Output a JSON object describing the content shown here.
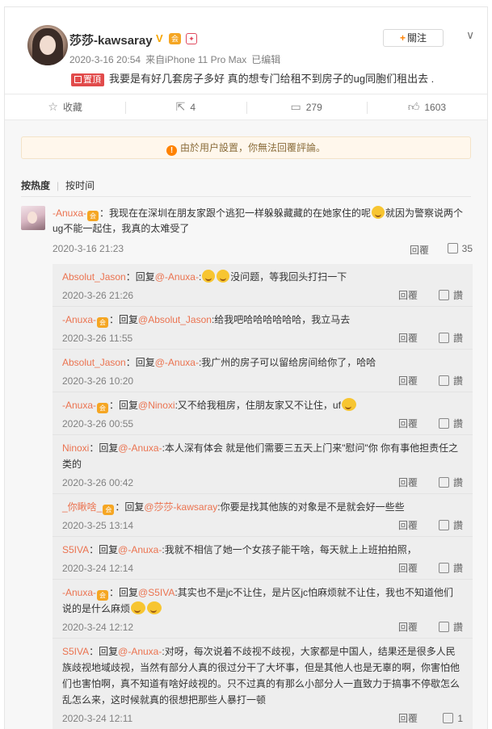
{
  "post": {
    "username": "莎莎-kawsaray",
    "verified_badge": "V",
    "level_badge": "会",
    "timestamp": "2020-3-16 20:54",
    "source": "来自iPhone 11 Pro Max",
    "edited": "已编辑",
    "follow_label": "關注",
    "pinned_tag": "置頂",
    "pinned_text": "我要是有好几套房子多好 真的想专门给租不到房子的ug同胞们租出去 ."
  },
  "actions": {
    "favorite": "收藏",
    "forward_count": "4",
    "comment_count": "279",
    "like_count": "1603"
  },
  "notice": "由於用户設置，你無法回覆評論。",
  "sort": {
    "hot": "按热度",
    "time": "按时间"
  },
  "top_comment": {
    "user": "-Anuxa-",
    "text_a": "：我现在在深圳在朋友家跟个逃犯一样躲躲藏藏的在她家住的呢",
    "text_b": "就因为警察说两个ug不能一起住，我真的太难受了",
    "time": "2020-3-16 21:23",
    "reply_label": "回覆",
    "likes": "35"
  },
  "replies": [
    {
      "user": "Absolut_Jason",
      "badge": false,
      "mention": "@-Anuxa-",
      "text": "没问题，等我回头打扫一下",
      "emo_before": 2,
      "time": "2020-3-26 21:26"
    },
    {
      "user": "-Anuxa-",
      "badge": true,
      "mention": "@Absolut_Jason",
      "text": "给我吧哈哈哈哈哈哈，我立马去",
      "emo_before": 0,
      "time": "2020-3-26 11:55"
    },
    {
      "user": "Absolut_Jason",
      "badge": false,
      "mention": "@-Anuxa-",
      "text": "我广州的房子可以留给房间给你了，哈哈",
      "emo_before": 0,
      "time": "2020-3-26 10:20"
    },
    {
      "user": "-Anuxa-",
      "badge": true,
      "mention": "@Ninoxi",
      "text": "又不给我租房，住朋友家又不让住，uf",
      "emo_after": 1,
      "time": "2020-3-26 00:55"
    },
    {
      "user": "Ninoxi",
      "badge": false,
      "mention": "@-Anuxa-",
      "text": "本人深有体会 就是他们需要三五天上门来\"慰问\"你 你有事他担责任之类的",
      "time": "2020-3-26 00:42"
    },
    {
      "user": "_你瞅啥_",
      "badge": true,
      "mention": "@莎莎-kawsaray",
      "text": "你要是找其他族的对象是不是就会好一些些",
      "time": "2020-3-25 13:14"
    },
    {
      "user": "S5IVA",
      "badge": false,
      "mention": "@-Anuxa-",
      "text": "我就不相信了她一个女孩子能干啥，每天就上上班拍拍照，",
      "time": "2020-3-24 12:14"
    },
    {
      "user": "-Anuxa-",
      "badge": true,
      "mention": "@S5IVA",
      "text": "其实也不是jc不让住，是片区jc怕麻烦就不让住，我也不知道他们说的是什么麻烦",
      "emo_after": 2,
      "time": "2020-3-24 12:12"
    },
    {
      "user": "S5IVA",
      "badge": false,
      "mention": "@-Anuxa-",
      "text": "对呀，每次说着不歧视不歧视，大家都是中国人，结果还是很多人民族歧视地域歧视，当然有部分人真的很过分干了大坏事，但是其他人也是无辜的啊，你害怕他们也害怕啊，真不知道有啥好歧视的。只不过真的有那么小部分人一直致力于搞事不停歇怎么乱怎么来，这时候就真的很想把那些人暴打一顿",
      "time": "2020-3-24 12:11",
      "likes": "1"
    }
  ],
  "reply_label": "回覆",
  "like_label": "讚",
  "icons": {
    "chevron": "chevron-down-icon",
    "favorite": "star-icon",
    "forward": "forward-icon",
    "comment": "comment-icon",
    "like": "thumb-up-icon",
    "warning": "warning-icon"
  }
}
